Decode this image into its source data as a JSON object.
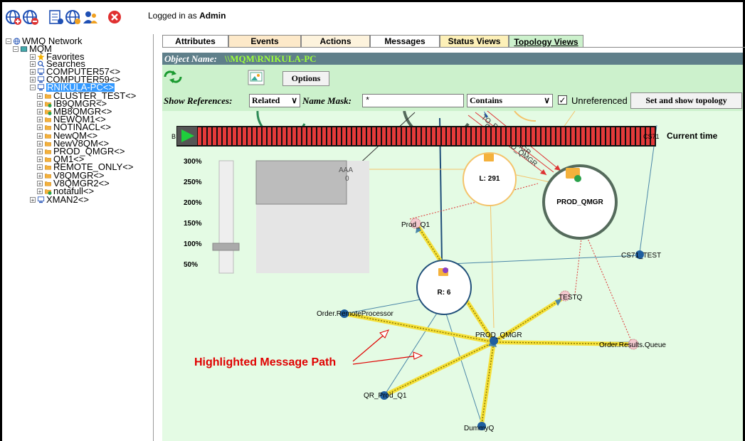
{
  "header": {
    "logged_in_prefix": "Logged in as ",
    "user": "Admin",
    "toolbar_icons": [
      "add-network-icon",
      "remove-network-icon",
      "report-icon",
      "network-settings-icon",
      "users-icon",
      "close-icon"
    ]
  },
  "tree": {
    "root": "WMQ Network",
    "group": "MQM",
    "items": [
      {
        "label": "Favorites",
        "icon": "star-icon"
      },
      {
        "label": "Searches",
        "icon": "search-icon"
      },
      {
        "label": "COMPUTER57<>",
        "icon": "computer-icon"
      },
      {
        "label": "COMPUTER59<>",
        "icon": "computer-icon"
      },
      {
        "label": "RNIKULA-PC<>",
        "icon": "computer-icon",
        "selected": true
      },
      {
        "label": "CLUSTER_TEST<>",
        "icon": "folder-icon"
      },
      {
        "label": "IB9QMGR<>",
        "icon": "folder-ok-icon"
      },
      {
        "label": "MB8QMGR<>",
        "icon": "folder-ok-icon"
      },
      {
        "label": "NEWQM1<>",
        "icon": "folder-icon"
      },
      {
        "label": "NOTINACL<>",
        "icon": "folder-icon"
      },
      {
        "label": "NewQM<>",
        "icon": "folder-icon"
      },
      {
        "label": "NewV8QM<>",
        "icon": "folder-icon"
      },
      {
        "label": "PROD_QMGR<>",
        "icon": "folder-icon"
      },
      {
        "label": "QM1<>",
        "icon": "folder-icon"
      },
      {
        "label": "REMOTE_ONLY<>",
        "icon": "folder-icon"
      },
      {
        "label": "V8QMGR<>",
        "icon": "folder-icon"
      },
      {
        "label": "V8QMGR2<>",
        "icon": "folder-icon"
      },
      {
        "label": "notafull<>",
        "icon": "folder-ok-icon"
      },
      {
        "label": "XMAN2<>",
        "icon": "computer-icon"
      }
    ]
  },
  "tabs": [
    {
      "label": "Attributes",
      "color": "#ffffff"
    },
    {
      "label": "Events",
      "color": "#fde9c9"
    },
    {
      "label": "Actions",
      "color": "#fdf3dd"
    },
    {
      "label": "Messages",
      "color": "#ffffff"
    },
    {
      "label": "Status Views",
      "color": "#fdf0b8"
    },
    {
      "label": "Topology Views",
      "color": "#ccf1cc",
      "active": true
    }
  ],
  "object": {
    "label": "Object Name:",
    "value": "\\\\MQM\\RNIKULA-PC"
  },
  "controls": {
    "options_label": "Options",
    "show_refs_label": "Show References:",
    "show_refs_value": "Related",
    "name_mask_label": "Name Mask:",
    "name_mask_value": "*",
    "match_value": "Contains",
    "unreferenced_label": "Unreferenced",
    "unreferenced_checked": true,
    "set_show_label": "Set and show topology"
  },
  "timeline": {
    "left_label": "B",
    "right_label": "CS71",
    "current_time_label": "Current time"
  },
  "zoom": {
    "levels": [
      "300%",
      "250%",
      "200%",
      "150%",
      "100%",
      "50%"
    ],
    "current_percent": 100
  },
  "overview": {
    "label1": "AAA",
    "label2": "0"
  },
  "graph": {
    "nodes": {
      "l_group": "L: 291",
      "r_group": "R: 6",
      "prod_qmgr": "PROD_QMGR",
      "prod_q1": "Prod_Q1",
      "cs71_test": "CS71_TEST",
      "testq": "TESTQ",
      "order_remote": "Order.RemoteProcessor",
      "prod_qmgr_small": "PROD_QMGR",
      "order_results": "Order.Results.Queue",
      "qr_prod_q1": "QR_Prod_Q1",
      "dummyq": "DummyQ",
      "chan1": "TO_PROD_QMGR",
      "chan2": "CHL_PROD_QMGR"
    },
    "highlight_color": "#f5e03a",
    "annotation": "Highlighted Message Path",
    "annotation_color": "#e00000"
  }
}
